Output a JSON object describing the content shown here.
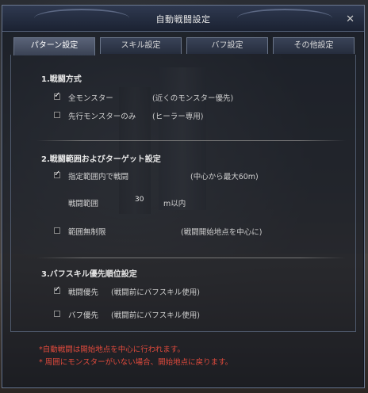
{
  "window": {
    "title": "自動戦闘設定",
    "close_icon": "close-icon"
  },
  "tabs": [
    {
      "label": "パターン設定",
      "active": true
    },
    {
      "label": "スキル設定",
      "active": false
    },
    {
      "label": "バフ設定",
      "active": false
    },
    {
      "label": "その他設定",
      "active": false
    }
  ],
  "section1": {
    "title": "1.戦闘方式",
    "options": [
      {
        "label": "全モンスター",
        "note": "(近くのモンスター優先)",
        "checked": true
      },
      {
        "label": "先行モンスターのみ",
        "note": "(ヒーラー専用)",
        "checked": false
      }
    ]
  },
  "section2": {
    "title": "2.戦闘範囲およびターゲット設定",
    "range_option": {
      "label": "指定範囲内で戦闘",
      "note": "(中心から最大60m)",
      "checked": true
    },
    "range_label": "戦闘範囲",
    "range_value": "30",
    "range_unit": "m以内",
    "unlimited_option": {
      "label": "範囲無制限",
      "note": "(戦闘開始地点を中心に)",
      "checked": false
    }
  },
  "section3": {
    "title": "3.バフスキル優先順位設定",
    "options": [
      {
        "label": "戦闘優先",
        "note": "(戦闘前にバフスキル使用)",
        "checked": true
      },
      {
        "label": "バフ優先",
        "note": "(戦闘前にバフスキル使用)",
        "checked": false
      }
    ]
  },
  "warnings": [
    "*自動戦闘は開始地点を中心に行われます。",
    "* 周囲にモンスターがいない場合、開始地点に戻ります。"
  ],
  "colors": {
    "warning": "#e04a3c",
    "frame": "#6b7890"
  }
}
